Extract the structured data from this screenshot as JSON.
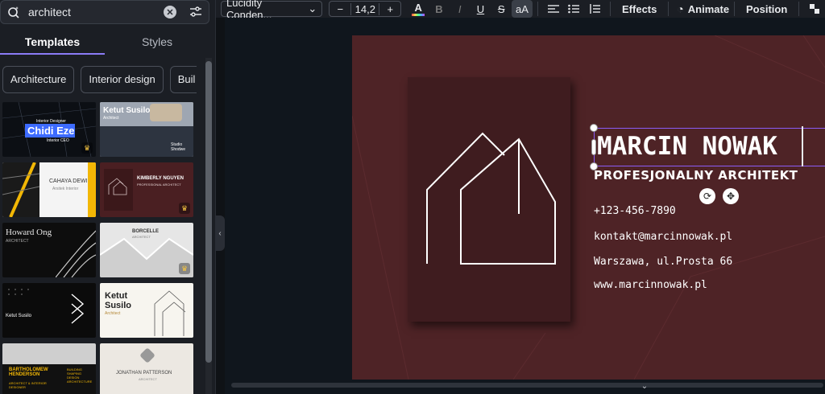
{
  "search": {
    "value": "architect"
  },
  "tabs": [
    {
      "label": "Templates"
    },
    {
      "label": "Styles"
    }
  ],
  "chips": [
    {
      "label": "Architecture"
    },
    {
      "label": "Interior design"
    },
    {
      "label": "Buil"
    }
  ],
  "templates": [
    {
      "name": "Chidi Eze",
      "line1": "Interior Designer",
      "line2": "Interior CEO"
    },
    {
      "name": "Ketut Susilo",
      "line1": "Architect",
      "line2": "Studio Shodwe"
    },
    {
      "name": "CAHAYA DEWI",
      "line1": "Arsitek Interior"
    },
    {
      "name": "KIMBERLY NGUYEN",
      "line1": "PROFESSIONAL ARCHITECT"
    },
    {
      "name": "Howard Ong",
      "line1": "ARCHITECT"
    },
    {
      "name": "BORCELLE",
      "line1": "ARCHITECT"
    },
    {
      "name": "Ketut Susilo",
      "line1": "Ketut",
      "line2": "Susilo",
      "line3": "Architect"
    },
    {
      "name": "BARTHOLOMEW HENDERSON",
      "line1": "ARCHITECT & INTERIOR DESIGNER",
      "line2": "BUILDING SHAPING DESIGN ARCHITECTURE"
    },
    {
      "name": "JONATHAN PATTERSON",
      "line1": "ARCHITECT"
    }
  ],
  "toolbar": {
    "font": "Lucidity Conden...",
    "size_minus": "−",
    "size": "14,2",
    "size_plus": "+",
    "text_color_letter": "A",
    "bold": "B",
    "italic": "I",
    "underline": "U",
    "strike": "S",
    "case": "aA",
    "effects": "Effects",
    "animate": "Animate",
    "position": "Position"
  },
  "card": {
    "name": "MARCIN NOWAK",
    "subtitle": "PROFESJONALNY ARCHITEKT",
    "phone": "+123-456-7890",
    "email": "kontakt@marcinnowak.pl",
    "address": "Warszawa, ul.Prosta 66",
    "website": "www.marcinnowak.pl"
  },
  "colors": {
    "accent": "#8b7cf6",
    "card_bg": "#4e2326",
    "card_front": "#3f1c1f",
    "selection": "#8b5cf6"
  }
}
